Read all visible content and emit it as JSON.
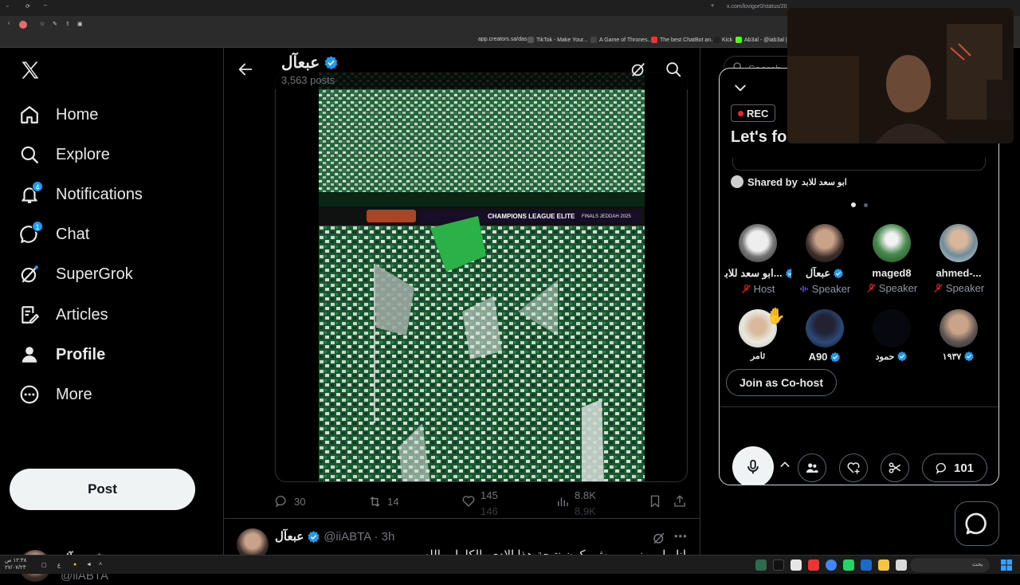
{
  "browser": {
    "url": "x.com/lovigor0/status/20",
    "bookmarks": [
      "app.creators.sa/das...",
      "TikTok - Make Your...",
      "A Game of Thrones...",
      "The best ChatBot an...",
      "Kick",
      "Ab3al - @iab3al |..."
    ]
  },
  "nav": {
    "home": "Home",
    "explore": "Explore",
    "notifications": "Notifications",
    "notifications_badge": "4",
    "chat": "Chat",
    "chat_badge": "1",
    "supergrok": "SuperGrok",
    "articles": "Articles",
    "profile": "Profile",
    "more": "More",
    "post": "Post",
    "account_name": "عبعآل",
    "account_handle": "@iiABTA"
  },
  "header": {
    "name": "عبعآل",
    "posts": "3,563 posts"
  },
  "media": {
    "banner_text": "CHAMPIONS LEAGUE ELITE",
    "banner_sub": "FINALS JEDDAH 2025"
  },
  "actions": {
    "replies": "30",
    "reposts": "14",
    "likes": "145",
    "views": "8.8K",
    "likes_next": "146",
    "views_next": "8.9K"
  },
  "tweet2": {
    "name": "عبعآل",
    "handle": "@iiABTA · 3h",
    "text": "انا ما يهمني ... وش يكون نتيجة هذا الادي بالكامل والله"
  },
  "space": {
    "rec": "REC",
    "title": "Let's fo",
    "shared_by_label": "Shared by",
    "shared_by_name": "ابو سعد للابد",
    "speakers": [
      {
        "name": "ابو سعد للابد...",
        "role": "Host",
        "verified": true
      },
      {
        "name": "عبعآل",
        "role": "Speaker",
        "verified": true
      },
      {
        "name": "maged8",
        "role": "Speaker",
        "verified": false
      },
      {
        "name": "ahmed-...",
        "role": "Speaker",
        "verified": false
      }
    ],
    "listeners": [
      {
        "name": "ثامر",
        "verified": false
      },
      {
        "name": "A90",
        "verified": true
      },
      {
        "name": "حمود",
        "verified": true
      },
      {
        "name": "١٩٣٧",
        "verified": true
      }
    ],
    "cohost": "Join as Co-host",
    "comments": "101"
  },
  "search": {
    "placeholder": "Search"
  },
  "taskbar": {
    "time": "١٢:٣٨ ص",
    "date": "٢٧/٠٧/٢٣",
    "lang": "ع",
    "search": "بحث"
  },
  "colors": {
    "accent": "#1d9bf0",
    "mute": "#f4212e",
    "bg": "#000000"
  }
}
